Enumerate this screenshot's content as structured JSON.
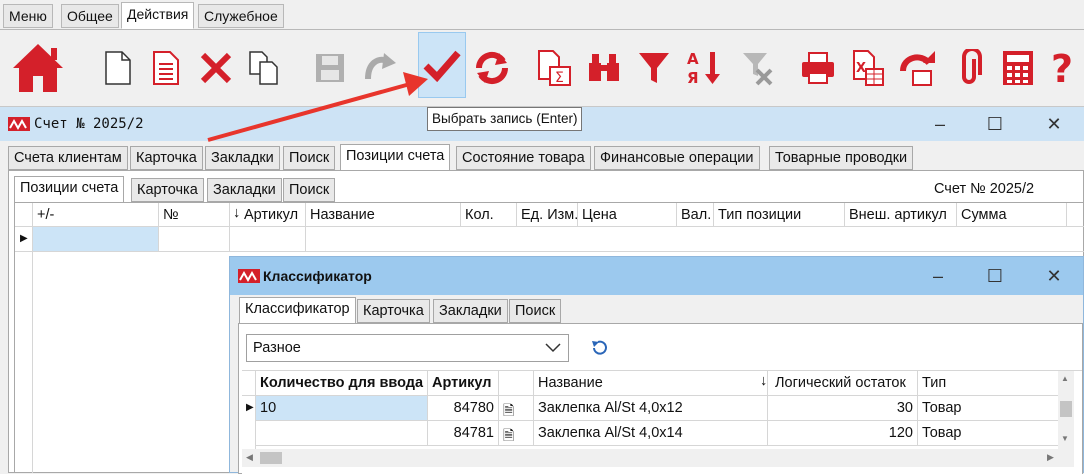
{
  "top_tabs": [
    "Меню",
    "Общее",
    "Действия",
    "Служебное"
  ],
  "toolbar": {
    "icons": [
      "home-icon",
      "new-document-icon",
      "edit-document-icon",
      "delete-icon",
      "copy-icon",
      "save-icon",
      "undo-icon",
      "select-record-icon",
      "refresh-icon",
      "calculate-icon",
      "binoculars-icon",
      "filter-icon",
      "sort-icon",
      "clear-filter-icon",
      "print-icon",
      "excel-export-icon",
      "goto-icon",
      "attach-icon",
      "calculator-icon",
      "help-icon"
    ],
    "tooltip": "Выбрать запись (Enter)"
  },
  "main_window": {
    "title": "Счет № 2025/2",
    "tabs": [
      "Счета клиентам",
      "Карточка",
      "Закладки",
      "Поиск",
      "Позиции счета",
      "Состояние товара",
      "Финансовые операции",
      "Товарные проводки"
    ],
    "subtabs": [
      "Позиции счета",
      "Карточка",
      "Закладки",
      "Поиск"
    ],
    "header_label": "Счет № 2025/2",
    "columns": [
      "+/-",
      "№",
      "Артикул",
      "Название",
      "Кол.",
      "Ед. Изм.",
      "Цена",
      "Вал.",
      "Тип позиции",
      "Внеш. артикул",
      "Сумма"
    ]
  },
  "classifier": {
    "title": "Классификатор",
    "tabs": [
      "Классификатор",
      "Карточка",
      "Закладки",
      "Поиск"
    ],
    "combo_value": "Разное",
    "columns": [
      "Количество для ввода",
      "Артикул",
      "",
      "Название",
      "Логический остаток",
      "Тип"
    ],
    "rows": [
      {
        "qty": "10",
        "article": "84780",
        "name": "Заклепка Al/St 4,0x12",
        "stock": "30",
        "type": "Товар"
      },
      {
        "qty": "",
        "article": "84781",
        "name": "Заклепка Al/St 4,0x14",
        "stock": "120",
        "type": "Товар"
      }
    ]
  },
  "colors": {
    "accent_red": "#d4202a",
    "title_blue": "#cde3f5",
    "classifier_title": "#9cc9ee",
    "selected_cell": "#cce4f7"
  }
}
